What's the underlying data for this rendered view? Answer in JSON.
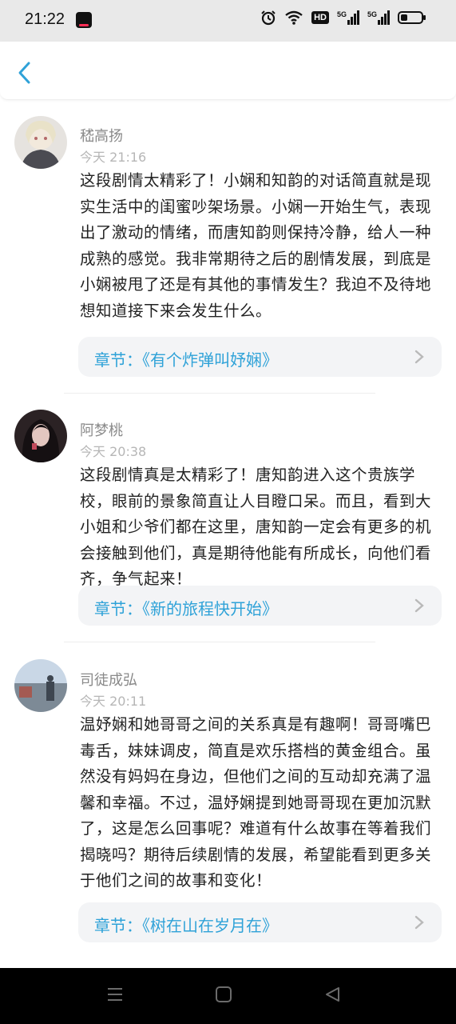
{
  "status_bar": {
    "time": "21:22",
    "icons": [
      "tiktok-app-icon",
      "alarm-icon",
      "wifi-icon",
      "hd-icon",
      "signal-5g-icon",
      "signal-5g-icon",
      "battery-icon"
    ],
    "hd_label": "HD",
    "net_label_1": "5G",
    "net_label_2": "5G"
  },
  "header": {
    "back_icon": "chevron-left-icon"
  },
  "comments": [
    {
      "username": "嵇高扬",
      "time": "今天 21:16",
      "text": "这段剧情太精彩了！小娴和知韵的对话简直就是现实生活中的闺蜜吵架场景。小娴一开始生气，表现出了激动的情绪，而唐知韵则保持冷静，给人一种成熟的感觉。我非常期待之后的剧情发展，到底是小娴被甩了还是有其他的事情发生？我迫不及待地想知道接下来会发生什么。",
      "chapter": "章节：《有个炸弹叫妤娴》"
    },
    {
      "username": "阿梦桃",
      "time": "今天 20:38",
      "text": "这段剧情真是太精彩了！唐知韵进入这个贵族学校，眼前的景象简直让人目瞪口呆。而且，看到大小姐和少爷们都在这里，唐知韵一定会有更多的机会接触到他们，真是期待他能有所成长，向他们看齐，争气起来！",
      "chapter": "章节：《新的旅程快开始》"
    },
    {
      "username": "司徒成弘",
      "time": "今天 20:11",
      "text": "温妤娴和她哥哥之间的关系真是有趣啊！哥哥嘴巴毒舌，妹妹调皮，简直是欢乐搭档的黄金组合。虽然没有妈妈在身边，但他们之间的互动却充满了温馨和幸福。不过，温妤娴提到她哥哥现在更加沉默了，这是怎么回事呢？难道有什么故事在等着我们揭晓吗？期待后续剧情的发展，希望能看到更多关于他们之间的故事和变化！",
      "chapter": "章节：《树在山在岁月在》"
    }
  ],
  "nav_bar": {
    "icons": [
      "menu-icon",
      "home-icon",
      "back-triangle-icon"
    ]
  },
  "colors": {
    "accent": "#2fa2d8",
    "status_bg": "#e9e9e9",
    "chapter_bg": "#f3f4f6"
  }
}
